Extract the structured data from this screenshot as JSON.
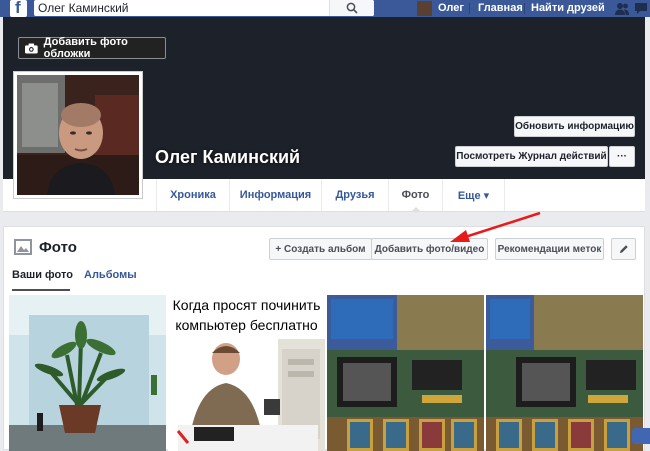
{
  "colors": {
    "fb_blue": "#3b5998",
    "link": "#365899",
    "arrow": "#e81b1b",
    "cover_bg": "#1d2129"
  },
  "topbar": {
    "logo": "f",
    "search_value": "Олег Каминский",
    "search_icon": "search-icon",
    "user_name": "Олег",
    "home_link": "Главная",
    "find_friends_link": "Найти друзей",
    "friend_requests_icon": "friends-icon"
  },
  "cover": {
    "add_cover_label": "Добавить фото обложки",
    "camera_icon": "camera-icon"
  },
  "profile": {
    "name": "Олег Каминский",
    "update_info_label": "Обновить информацию",
    "activity_log_label": "Посмотреть Журнал действий",
    "more_label": "···"
  },
  "tabs": [
    {
      "label": "Хроника"
    },
    {
      "label": "Информация"
    },
    {
      "label": "Друзья"
    },
    {
      "label": "Фото"
    },
    {
      "label": "Еще ▾"
    }
  ],
  "photos_panel": {
    "title": "Фото",
    "create_album_label": "+ Создать альбом",
    "add_photo_video_label": "Добавить фото/видео",
    "tag_suggestions_label": "Рекомендации меток",
    "edit_icon": "pencil-icon",
    "subtabs": {
      "your_photos": "Ваши фото",
      "albums": "Альбомы"
    },
    "meme_text_line1": "Когда просят починить",
    "meme_text_line2": "компьютер бесплатно"
  }
}
